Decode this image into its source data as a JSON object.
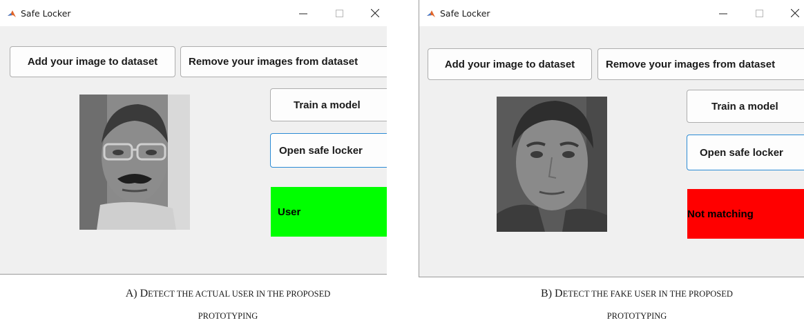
{
  "panels": [
    {
      "window_title": "Safe Locker",
      "buttons": {
        "add_image": "Add your image to dataset",
        "remove_images": "Remove your images from dataset",
        "train_model": "Train a model",
        "open_locker": "Open safe locker"
      },
      "status": {
        "text": "User",
        "color": "#00ff00"
      },
      "caption_prefix": "A) D",
      "caption_rest": "ETECT THE ACTUAL USER IN THE PROPOSED",
      "caption_line2": "PROTOTYPING"
    },
    {
      "window_title": "Safe Locker",
      "buttons": {
        "add_image": "Add your image to dataset",
        "remove_images": "Remove your images from dataset",
        "train_model": "Train a model",
        "open_locker": "Open safe locker"
      },
      "status": {
        "text": "Not matching",
        "color": "#ff0000"
      },
      "caption_prefix": "B) D",
      "caption_rest": "ETECT THE FAKE USER IN THE PROPOSED",
      "caption_line2": "PROTOTYPING"
    }
  ],
  "icons": {
    "app": "matlab-logo-icon",
    "minimize": "minimize-icon",
    "maximize": "maximize-icon",
    "close": "close-icon"
  }
}
